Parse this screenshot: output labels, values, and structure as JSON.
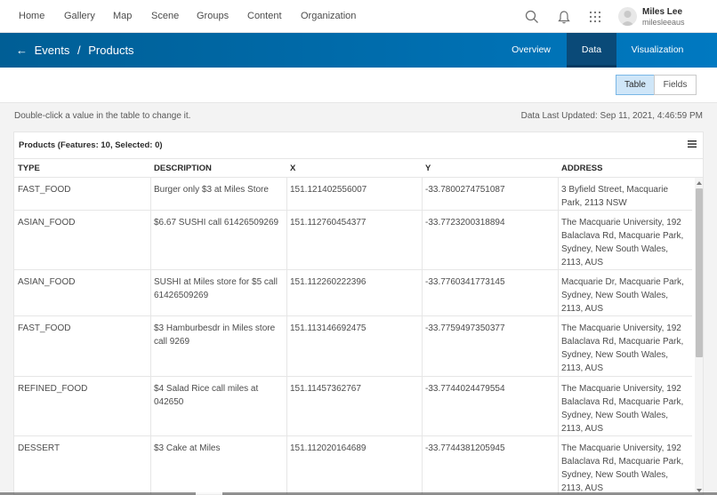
{
  "nav": {
    "links": [
      "Home",
      "Gallery",
      "Map",
      "Scene",
      "Groups",
      "Content",
      "Organization"
    ],
    "user_name": "Miles Lee",
    "user_id": "milesleeaus"
  },
  "header": {
    "back_arrow": "←",
    "crumb_1": "Events",
    "separator": "/",
    "crumb_2": "Products",
    "tabs": [
      "Overview",
      "Data",
      "Visualization"
    ],
    "active_tab": "Data"
  },
  "toolbar": {
    "table_label": "Table",
    "fields_label": "Fields",
    "active_view": "Table"
  },
  "info": {
    "hint": "Double-click a value in the table to change it.",
    "updated": "Data Last Updated: Sep 11, 2021, 4:46:59 PM"
  },
  "table": {
    "title": "Products (Features: 10, Selected: 0)",
    "columns": [
      "TYPE",
      "DESCRIPTION",
      "X",
      "Y",
      "ADDRESS"
    ],
    "rows": [
      {
        "type": "FAST_FOOD",
        "description": "Burger only $3 at Miles Store",
        "x": "151.121402556007",
        "y": "-33.7800274751087",
        "address": "3 Byfield Street, Macquarie Park, 2113 NSW"
      },
      {
        "type": "ASIAN_FOOD",
        "description": "$6.67 SUSHI call 61426509269",
        "x": "151.112760454377",
        "y": "-33.7723200318894",
        "address": "The Macquarie University, 192 Balaclava Rd, Macquarie Park, Sydney, New South Wales, 2113, AUS"
      },
      {
        "type": "ASIAN_FOOD",
        "description": "SUSHI at Miles store for $5 call 61426509269",
        "x": "151.112260222396",
        "y": "-33.7760341773145",
        "address": "Macquarie Dr, Macquarie Park, Sydney, New South Wales, 2113, AUS"
      },
      {
        "type": "FAST_FOOD",
        "description": "$3 Hamburbesdr in Miles store call 9269",
        "x": "151.113146692475",
        "y": "-33.7759497350377",
        "address": "The Macquarie University, 192 Balaclava Rd, Macquarie Park, Sydney, New South Wales, 2113, AUS"
      },
      {
        "type": "REFINED_FOOD",
        "description": "$4 Salad Rice call miles at 042650",
        "x": "151.11457362767",
        "y": "-33.7744024479554",
        "address": "The Macquarie University, 192 Balaclava Rd, Macquarie Park, Sydney, New South Wales, 2113, AUS"
      },
      {
        "type": "DESSERT",
        "description": "$3 Cake at Miles",
        "x": "151.112020164689",
        "y": "-33.7744381205945",
        "address": "The Macquarie University, 192 Balaclava Rd, Macquarie Park, Sydney, New South Wales, 2113, AUS"
      }
    ]
  },
  "icons": {
    "search": "search-icon",
    "notifications": "bell-icon",
    "apps": "app-grid-icon",
    "avatar": "user-avatar-icon",
    "table_menu": "hamburger-menu-icon"
  },
  "colors": {
    "header_blue": "#0079c1",
    "active_tab": "#0a4a78",
    "segment_active": "#cfe6f8"
  }
}
